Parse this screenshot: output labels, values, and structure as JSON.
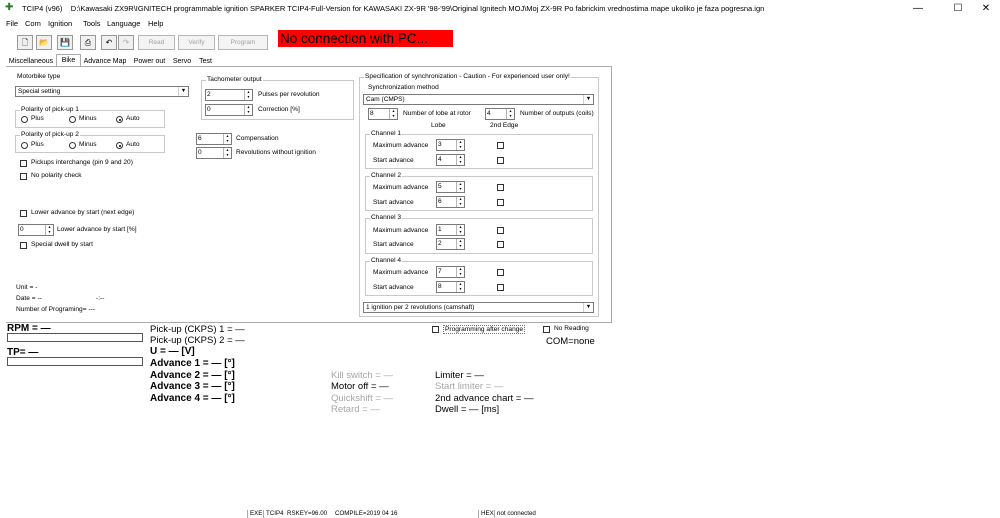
{
  "window": {
    "app_name": "TCIP4 (v96)",
    "path": "D:\\Kawasaki ZX9R\\IGNITECH programmable ignition SPARKER TCIP4-Full-Version for KAWASAKI ZX-9R '98-'99\\Original Ignitech MOJ\\Moj ZX-9R Po fabrickim vrednostima mape ukoliko je faza pogresna.ign",
    "minimize": "—",
    "maximize": "☐",
    "close": "✕"
  },
  "menu": [
    "File",
    "Com",
    "Ignition",
    "Tools",
    "Language",
    "Help"
  ],
  "toolbar": {
    "read": "Read",
    "verify": "Verify",
    "program": "Program",
    "icons": [
      "new-file-icon",
      "open-folder-icon",
      "save-icon",
      "print-icon",
      "undo-icon",
      "redo-icon"
    ]
  },
  "connection_banner": "No connection with PC...",
  "tabs": [
    "Miscellaneous",
    "Bike",
    "Advance Map",
    "Power out",
    "Servo",
    "Test"
  ],
  "active_tab": "Bike",
  "bike": {
    "motorbike_type_label": "Motorbike type",
    "motorbike_type_value": "Special setting",
    "polarity1": {
      "title": "Polarity of pick-up 1",
      "options": [
        "Plus",
        "Minus",
        "Auto"
      ],
      "selected": "Auto"
    },
    "polarity2": {
      "title": "Polarity of pick-up 2",
      "options": [
        "Plus",
        "Minus",
        "Auto"
      ],
      "selected": "Auto"
    },
    "pickups_interchange": "Pickups interchange (pin 9 and 20)",
    "no_polarity_check": "No polarity check",
    "lower_advance_by_start_edge": "Lower advance by start (next edge)",
    "lower_advance_value": "0",
    "lower_advance_pct": "Lower advance by start [%]",
    "special_dwell": "Special dwell by start",
    "unit": "Unit = -",
    "date": "Date = --",
    "date_suffix": "-:--",
    "num_programing": "Number of Programing= ---"
  },
  "tacho": {
    "title": "Tachometer output",
    "pulses_value": "2",
    "pulses_label": "Pulses per revolution",
    "correction_value": "0",
    "correction_label": "Correction [%]",
    "compensation_value": "6",
    "compensation_label": "Compensation",
    "rev_without_ign_value": "0",
    "rev_without_ign_label": "Revolutions without ignition"
  },
  "sync": {
    "title": "Specification of synchronization - Caution - For experienced user only!",
    "method_label": "Synchronization method",
    "method_value": "Cam (CMPS)",
    "lobes_value": "8",
    "lobes_label": "Number of lobe at rotor",
    "outputs_value": "4",
    "outputs_label": "Number of outputs (coils)",
    "col_lobe": "Lobe",
    "col_2nd_edge": "2nd Edge",
    "max_adv_label": "Maximum advance",
    "start_adv_label": "Start advance",
    "channels": [
      {
        "name": "Channel 1",
        "max": "3",
        "start": "4"
      },
      {
        "name": "Channel 2",
        "max": "5",
        "start": "6"
      },
      {
        "name": "Channel 3",
        "max": "1",
        "start": "2"
      },
      {
        "name": "Channel 4",
        "max": "7",
        "start": "8"
      }
    ],
    "ignition_mode": "1 ignition per 2 revolutions (camshaft)"
  },
  "bottom": {
    "programming_after_change": "Programming after change",
    "no_reading": "No Reading",
    "com": "COM=none",
    "rpm": "RPM = —",
    "tp": "TP= —",
    "pickup1": "Pick-up (CKPS) 1 = —",
    "pickup2": "Pick-up (CKPS) 2 = —",
    "voltage": "U = — [V]",
    "adv1": "Advance 1 = — [°]",
    "adv2": "Advance 2 = — [°]",
    "adv3": "Advance 3 = — [°]",
    "adv4": "Advance 4 = — [°]",
    "kill_switch": "Kill switch = —",
    "motor_off": "Motor off = —",
    "quickshift": "Quickshift = —",
    "retard": "Retard = —",
    "limiter": "Limiter = —",
    "start_limiter": "Start limiter = —",
    "second_chart": "2nd advance chart = —",
    "dwell": "Dwell = — [ms]"
  },
  "status": {
    "exe": "EXE",
    "device": "TCIP4",
    "rskey": "RSKEY=96.00",
    "compile": "COMPILE=2019 04 16",
    "hex": "HEX",
    "conn": "not connected"
  }
}
